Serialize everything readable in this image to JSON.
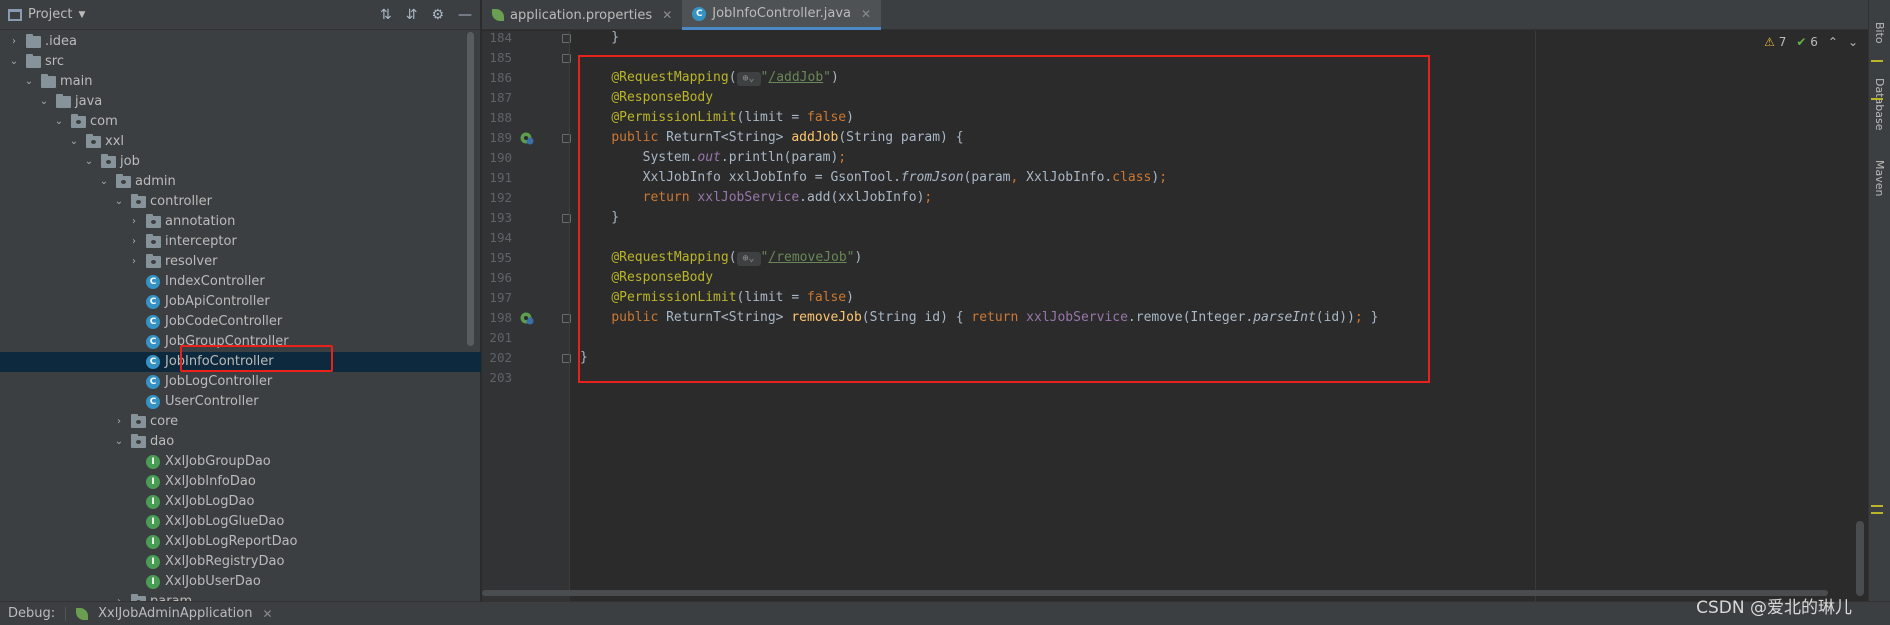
{
  "project_panel": {
    "title": "Project",
    "tree": [
      {
        "label": ".idea",
        "type": "folder",
        "depth": 0,
        "arrow": "›"
      },
      {
        "label": "src",
        "type": "folder",
        "depth": 0,
        "arrow": "⌄"
      },
      {
        "label": "main",
        "type": "folder",
        "depth": 1,
        "arrow": "⌄"
      },
      {
        "label": "java",
        "type": "folder",
        "depth": 2,
        "arrow": "⌄"
      },
      {
        "label": "com",
        "type": "package",
        "depth": 3,
        "arrow": "⌄"
      },
      {
        "label": "xxl",
        "type": "package",
        "depth": 4,
        "arrow": "⌄"
      },
      {
        "label": "job",
        "type": "package",
        "depth": 5,
        "arrow": "⌄"
      },
      {
        "label": "admin",
        "type": "package",
        "depth": 6,
        "arrow": "⌄"
      },
      {
        "label": "controller",
        "type": "package",
        "depth": 7,
        "arrow": "⌄"
      },
      {
        "label": "annotation",
        "type": "package",
        "depth": 8,
        "arrow": "›"
      },
      {
        "label": "interceptor",
        "type": "package",
        "depth": 8,
        "arrow": "›"
      },
      {
        "label": "resolver",
        "type": "package",
        "depth": 8,
        "arrow": "›"
      },
      {
        "label": "IndexController",
        "type": "class",
        "depth": 8,
        "arrow": ""
      },
      {
        "label": "JobApiController",
        "type": "class",
        "depth": 8,
        "arrow": ""
      },
      {
        "label": "JobCodeController",
        "type": "class",
        "depth": 8,
        "arrow": ""
      },
      {
        "label": "JobGroupController",
        "type": "class",
        "depth": 8,
        "arrow": ""
      },
      {
        "label": "JobInfoController",
        "type": "class",
        "depth": 8,
        "arrow": "",
        "selected": true
      },
      {
        "label": "JobLogController",
        "type": "class",
        "depth": 8,
        "arrow": ""
      },
      {
        "label": "UserController",
        "type": "class",
        "depth": 8,
        "arrow": ""
      },
      {
        "label": "core",
        "type": "package",
        "depth": 7,
        "arrow": "›"
      },
      {
        "label": "dao",
        "type": "package",
        "depth": 7,
        "arrow": "⌄"
      },
      {
        "label": "XxlJobGroupDao",
        "type": "interface",
        "depth": 8,
        "arrow": ""
      },
      {
        "label": "XxlJobInfoDao",
        "type": "interface",
        "depth": 8,
        "arrow": ""
      },
      {
        "label": "XxlJobLogDao",
        "type": "interface",
        "depth": 8,
        "arrow": ""
      },
      {
        "label": "XxlJobLogGlueDao",
        "type": "interface",
        "depth": 8,
        "arrow": ""
      },
      {
        "label": "XxlJobLogReportDao",
        "type": "interface",
        "depth": 8,
        "arrow": ""
      },
      {
        "label": "XxlJobRegistryDao",
        "type": "interface",
        "depth": 8,
        "arrow": ""
      },
      {
        "label": "XxlJobUserDao",
        "type": "interface",
        "depth": 8,
        "arrow": ""
      },
      {
        "label": "param",
        "type": "package",
        "depth": 7,
        "arrow": "›"
      }
    ]
  },
  "tabs": [
    {
      "label": "application.properties",
      "icon": "spring-leaf-icon",
      "active": false
    },
    {
      "label": "JobInfoController.java",
      "icon": "class-icon",
      "active": true
    }
  ],
  "inspections": {
    "warnings": "7",
    "ok": "6"
  },
  "editor": {
    "lines": [
      {
        "num": "184",
        "html": "    }"
      },
      {
        "num": "185",
        "html": ""
      },
      {
        "num": "186",
        "html": "    <span class=\"ann\">@RequestMapping</span>(<span class=\"globe\">⊕⌄</span><span class=\"str\">\"</span><span class=\"strlink\">/addJob</span><span class=\"str\">\"</span>)"
      },
      {
        "num": "187",
        "html": "    <span class=\"ann\">@ResponseBody</span>"
      },
      {
        "num": "188",
        "html": "    <span class=\"ann\">@PermissionLimit</span>(limit = <span class=\"kw\">false</span>)"
      },
      {
        "num": "189",
        "html": "    <span class=\"kw\">public</span> ReturnT&lt;String&gt; <span class=\"fn\">addJob</span>(String param) {",
        "bean": true
      },
      {
        "num": "190",
        "html": "        System.<span class=\"fld it\">out</span>.println(param)<span class=\"kw\">;</span>"
      },
      {
        "num": "191",
        "html": "        XxlJobInfo xxlJobInfo = GsonTool.<span class=\"it\">fromJson</span>(param<span class=\"kw\">,</span> XxlJobInfo.<span class=\"kw\">class</span>)<span class=\"kw\">;</span>"
      },
      {
        "num": "192",
        "html": "        <span class=\"kw\">return</span> <span class=\"fld\">xxlJobService</span>.add(xxlJobInfo)<span class=\"kw\">;</span>"
      },
      {
        "num": "193",
        "html": "    }"
      },
      {
        "num": "194",
        "html": ""
      },
      {
        "num": "195",
        "html": "    <span class=\"ann\">@RequestMapping</span>(<span class=\"globe\">⊕⌄</span><span class=\"str\">\"</span><span class=\"strlink\">/removeJob</span><span class=\"str\">\"</span>)"
      },
      {
        "num": "196",
        "html": "    <span class=\"ann\">@ResponseBody</span>"
      },
      {
        "num": "197",
        "html": "    <span class=\"ann\">@PermissionLimit</span>(limit = <span class=\"kw\">false</span>)"
      },
      {
        "num": "198",
        "html": "    <span class=\"kw\">public</span> ReturnT&lt;String&gt; <span class=\"fn\">removeJob</span>(String id) { <span class=\"kw\">return</span> <span class=\"fld\">xxlJobService</span>.remove(Integer.<span class=\"it\">parseInt</span>(id))<span class=\"kw\">;</span> }",
        "bean": true
      },
      {
        "num": "201",
        "html": ""
      },
      {
        "num": "202",
        "html": "}"
      },
      {
        "num": "203",
        "html": ""
      }
    ]
  },
  "right_strip": {
    "labels": [
      "Bito",
      "Database",
      "Maven"
    ]
  },
  "debug_bar": {
    "label": "Debug:",
    "config": "XxlJobAdminApplication"
  },
  "watermark": "CSDN @爱北的琳儿",
  "colors": {
    "highlight_box": "#e8211b",
    "selection": "#0d293e",
    "accent_tab": "#4a88c7"
  }
}
